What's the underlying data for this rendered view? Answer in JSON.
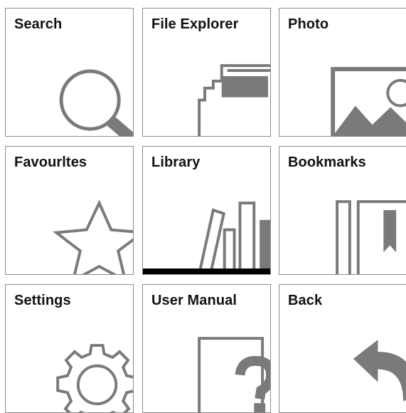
{
  "tiles": [
    {
      "label": "Search",
      "icon": "search-icon"
    },
    {
      "label": "File Explorer",
      "icon": "folder-icon"
    },
    {
      "label": "Photo",
      "icon": "image-icon"
    },
    {
      "label": "Favourltes",
      "icon": "star-icon"
    },
    {
      "label": "Library",
      "icon": "books-icon"
    },
    {
      "label": "Bookmarks",
      "icon": "bookmark-icon"
    },
    {
      "label": "Settings",
      "icon": "gear-icon"
    },
    {
      "label": "User Manual",
      "icon": "help-document-icon"
    },
    {
      "label": "Back",
      "icon": "back-arrow-icon"
    }
  ],
  "colors": {
    "border": "#8a8a8a",
    "icon": "#7a7a7a",
    "text": "#111111",
    "accent_bar": "#000000"
  }
}
